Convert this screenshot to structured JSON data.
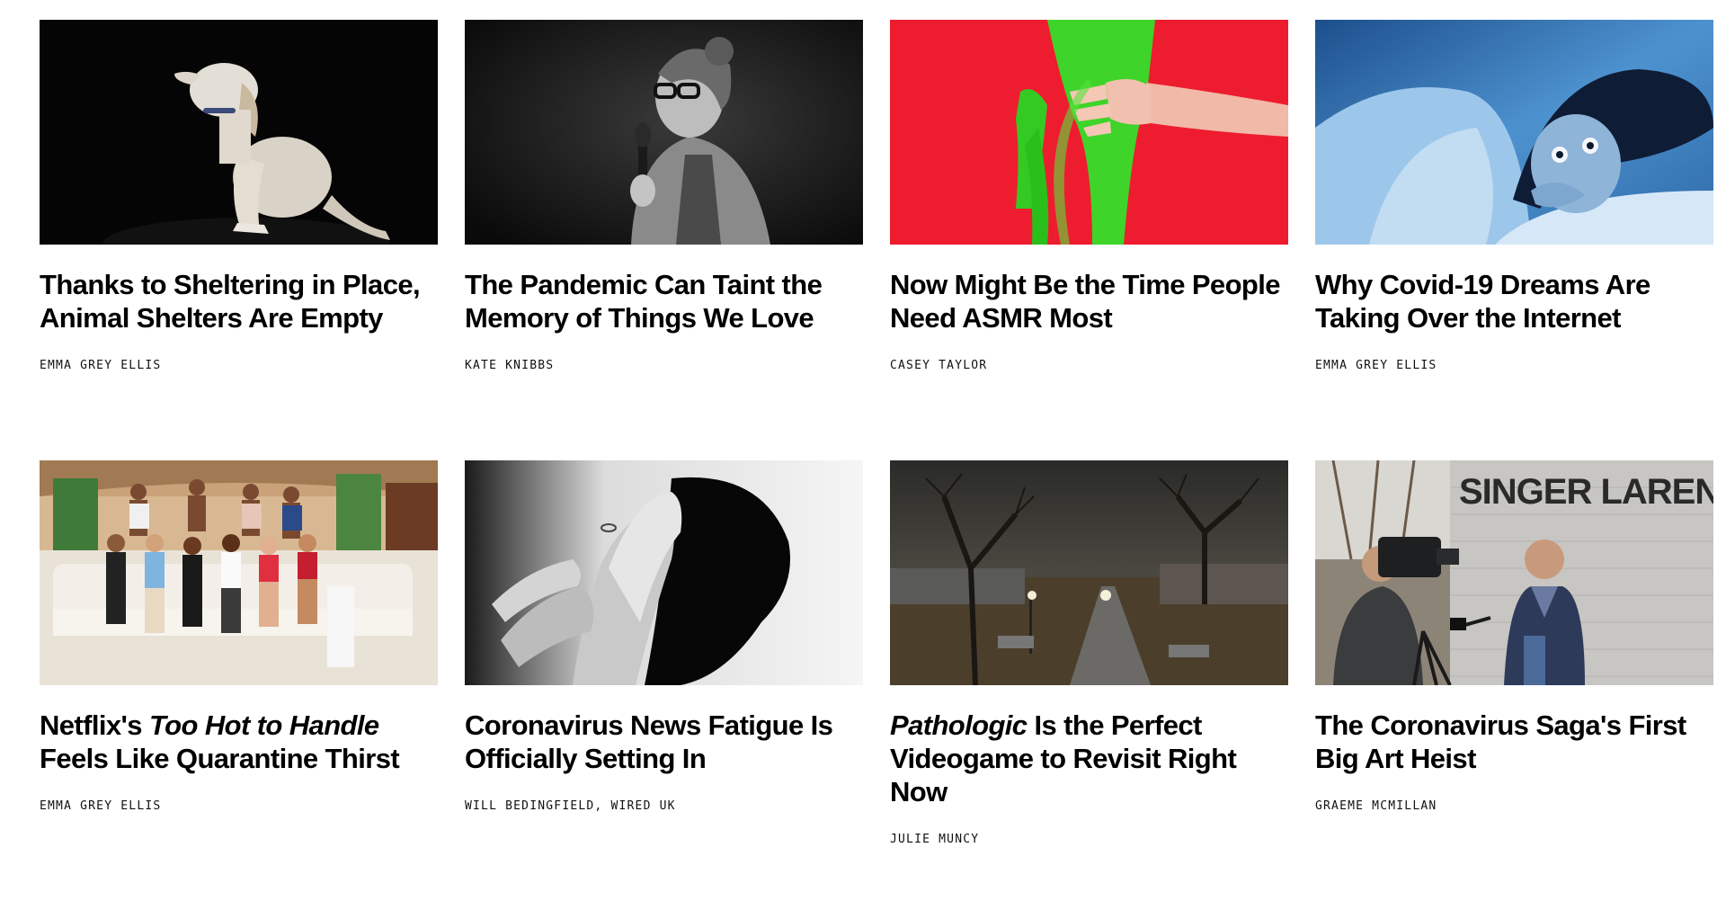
{
  "articles": [
    {
      "image": "dog-on-black-background",
      "title_parts": [
        "Thanks to Sheltering in Place, Animal Shelters Are Empty"
      ],
      "author": "EMMA GREY ELLIS"
    },
    {
      "image": "comedian-with-microphone-bw",
      "title_parts": [
        "The Pandemic Can Taint the Memory of Things We Love"
      ],
      "author": "KATE KNIBBS"
    },
    {
      "image": "hand-holding-green-slime",
      "title_parts": [
        "Now Might Be the Time People Need ASMR Most"
      ],
      "author": "CASEY TAYLOR"
    },
    {
      "image": "woman-in-bed-blue",
      "title_parts": [
        "Why Covid-19 Dreams Are Taking Over the Internet"
      ],
      "author": "EMMA GREY ELLIS"
    },
    {
      "image": "reality-show-cast-on-couch",
      "title_parts": [
        "Netflix's ",
        "Too Hot to Handle",
        " Feels Like Quarantine Thirst"
      ],
      "author": "EMMA GREY ELLIS"
    },
    {
      "image": "clasped-hands-shadow-bw",
      "title_parts": [
        "Coronavirus News Fatigue Is Officially Setting In"
      ],
      "author": "WILL BEDINGFIELD, WIRED UK"
    },
    {
      "image": "videogame-night-park",
      "title_parts": [
        "",
        "Pathologic",
        " Is the Perfect Videogame to Revisit Right Now"
      ],
      "author": "JULIE MUNCY"
    },
    {
      "image": "reporter-at-singer-laren",
      "image_sign": "SINGER LAREN",
      "title_parts": [
        "The Coronavirus Saga's First Big Art Heist"
      ],
      "author": "GRAEME MCMILLAN"
    }
  ]
}
